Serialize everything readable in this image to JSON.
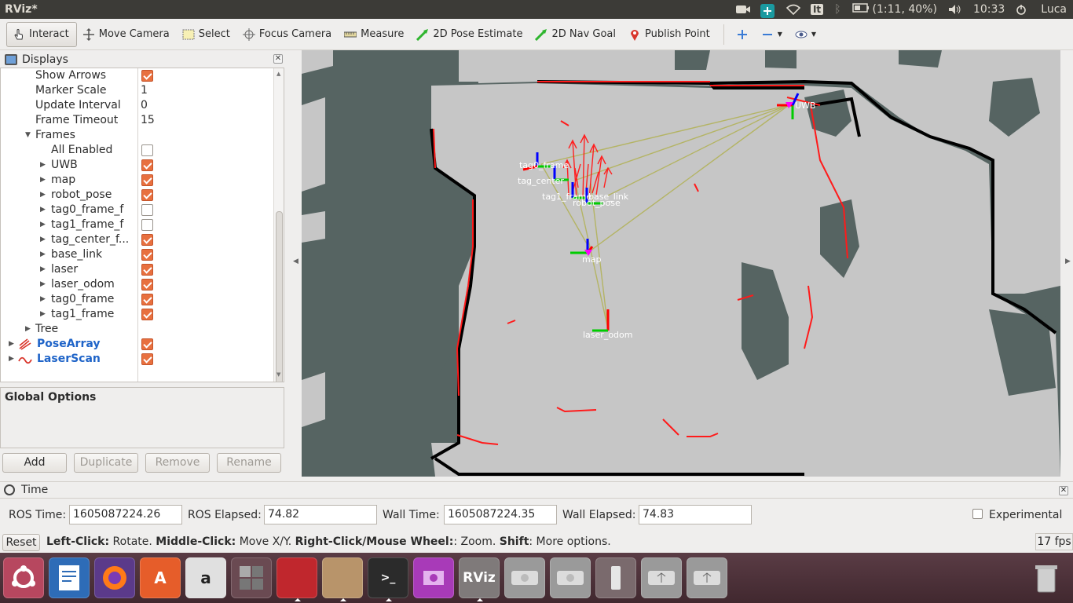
{
  "topbar": {
    "title": "RViz*",
    "keyboard_layout": "It",
    "battery": "(1:11, 40%)",
    "clock": "10:33",
    "user": "Luca",
    "icons": [
      "camera-icon",
      "teamviewer-icon",
      "wifi-icon",
      "keyboard-icon",
      "bluetooth-icon",
      "battery-icon",
      "volume-icon",
      "power-icon"
    ]
  },
  "toolbar": {
    "tools": [
      {
        "label": "Interact",
        "icon": "hand-pointer-icon",
        "active": true
      },
      {
        "label": "Move Camera",
        "icon": "move-camera-icon"
      },
      {
        "label": "Select",
        "icon": "select-box-icon"
      },
      {
        "label": "Focus Camera",
        "icon": "focus-camera-icon"
      },
      {
        "label": "Measure",
        "icon": "ruler-icon"
      },
      {
        "label": "2D Pose Estimate",
        "icon": "pose-estimate-arrow-icon"
      },
      {
        "label": "2D Nav Goal",
        "icon": "nav-goal-arrow-icon"
      },
      {
        "label": "Publish Point",
        "icon": "map-pin-icon"
      }
    ],
    "extra_icons": [
      "plus-icon",
      "minus-icon",
      "eye-icon"
    ]
  },
  "displays": {
    "title": "Displays",
    "rows": [
      {
        "name": "Show Arrows",
        "value": "",
        "checkbox": true
      },
      {
        "name": "Marker Scale",
        "value": "1"
      },
      {
        "name": "Update Interval",
        "value": "0"
      },
      {
        "name": "Frame Timeout",
        "value": "15"
      },
      {
        "name": "Frames",
        "value": "",
        "expanded": true
      },
      {
        "name": "All Enabled",
        "value": "",
        "checkbox": false
      },
      {
        "name": "UWB",
        "value": "",
        "checkbox": true
      },
      {
        "name": "map",
        "value": "",
        "checkbox": true
      },
      {
        "name": "robot_pose",
        "value": "",
        "checkbox": true
      },
      {
        "name": "tag0_frame_f",
        "value": "",
        "checkbox": false
      },
      {
        "name": "tag1_frame_f",
        "value": "",
        "checkbox": false
      },
      {
        "name": "tag_center_f...",
        "value": "",
        "checkbox": true
      },
      {
        "name": "base_link",
        "value": "",
        "checkbox": true
      },
      {
        "name": "laser",
        "value": "",
        "checkbox": true
      },
      {
        "name": "laser_odom",
        "value": "",
        "checkbox": true
      },
      {
        "name": "tag0_frame",
        "value": "",
        "checkbox": true
      },
      {
        "name": "tag1_frame",
        "value": "",
        "checkbox": true
      },
      {
        "name": "Tree",
        "value": ""
      },
      {
        "name": "PoseArray",
        "value": "",
        "checkbox": true
      },
      {
        "name": "LaserScan",
        "value": "",
        "checkbox": true
      }
    ],
    "global_options": "Global Options",
    "buttons": {
      "add": "Add",
      "duplicate": "Duplicate",
      "remove": "Remove",
      "rename": "Rename"
    }
  },
  "viewport": {
    "frame_labels": [
      "tag0_frame",
      "tag_center",
      "tag1_frame",
      "base_link",
      "robot_pose",
      "map",
      "laser_odom",
      "UWB"
    ],
    "colors": {
      "background": "#566462",
      "free": "#c8c8c8",
      "occupied": "#000000",
      "scan": "#ff0000",
      "tf_line": "#b4b464"
    }
  },
  "time": {
    "title": "Time",
    "ros_time_label": "ROS Time:",
    "ros_time": "1605087224.26",
    "ros_elapsed_label": "ROS Elapsed:",
    "ros_elapsed": "74.82",
    "wall_time_label": "Wall Time:",
    "wall_time": "1605087224.35",
    "wall_elapsed_label": "Wall Elapsed:",
    "wall_elapsed": "74.83",
    "experimental": "Experimental"
  },
  "status": {
    "reset": "Reset",
    "hint_parts": [
      {
        "b": "Left-Click:",
        "t": " Rotate. "
      },
      {
        "b": "Middle-Click:",
        "t": " Move X/Y. "
      },
      {
        "b": "Right-Click/Mouse Wheel:",
        "t": ": Zoom. "
      },
      {
        "b": "Shift",
        "t": ": More options."
      }
    ],
    "fps": "17 fps"
  },
  "launcher": {
    "apps": [
      "ubuntu-dash-icon",
      "writer-icon",
      "firefox-icon",
      "software-center-icon",
      "amazon-icon",
      "workspaces-icon",
      "screen-recorder-icon",
      "file-manager-icon",
      "terminal-icon",
      "video-icon",
      "rviz-icon",
      "drive-icon",
      "drive-2-icon",
      "usb-drive-icon",
      "usb-drive-2-icon",
      "usb-drive-3-icon",
      "trash-icon"
    ]
  }
}
